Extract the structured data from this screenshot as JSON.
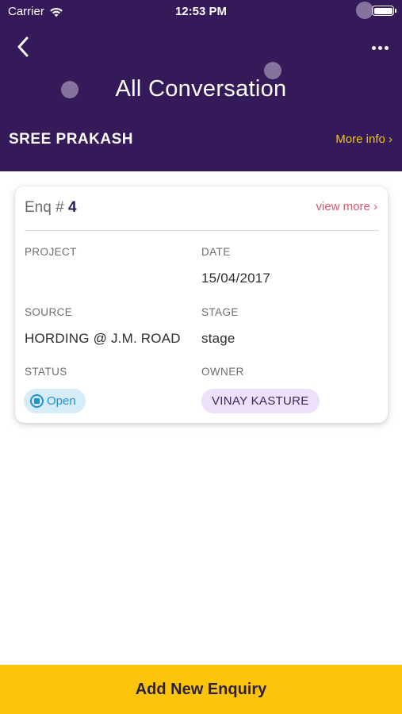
{
  "status_bar": {
    "carrier": "Carrier",
    "time": "12:53 PM"
  },
  "header": {
    "title": "All Conversation",
    "customer_name": "SREE PRAKASH",
    "more_info_label": "More info ›",
    "back_icon": "chevron-left-icon",
    "menu_icon": "more-horizontal-icon"
  },
  "card": {
    "enq_prefix": "Enq # ",
    "enq_number": "4",
    "view_more_label": "view more ›",
    "fields": {
      "project_label": "PROJECT",
      "project_value": "",
      "date_label": "DATE",
      "date_value": "15/04/2017",
      "source_label": "SOURCE",
      "source_value": "HORDING @ J.M. ROAD",
      "stage_label": "STAGE",
      "stage_value": "stage",
      "status_label": "STATUS",
      "status_value": "Open",
      "owner_label": "OWNER",
      "owner_value": "VINAY KASTURE"
    }
  },
  "footer": {
    "add_button_label": "Add New Enquiry"
  },
  "colors": {
    "header_bg": "#341a59",
    "accent_yellow": "#fcc50a",
    "more_info": "#f4c20d",
    "view_more": "#e0556a",
    "status_open": "#1c93d6"
  }
}
